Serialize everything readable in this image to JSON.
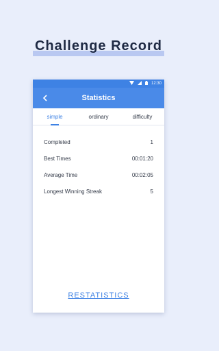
{
  "headline": {
    "title": "Challenge Record"
  },
  "status_bar": {
    "time": "12:30",
    "wifi_icon": "wifi-icon",
    "signal_icon": "signal-icon",
    "battery_icon": "battery-icon"
  },
  "toolbar": {
    "title": "Statistics",
    "back_icon": "back-arrow-icon"
  },
  "tabs": [
    {
      "label": "simple",
      "active": true
    },
    {
      "label": "ordinary",
      "active": false
    },
    {
      "label": "difficulty",
      "active": false
    }
  ],
  "stats": [
    {
      "label": "Completed",
      "value": "1"
    },
    {
      "label": "Best Times",
      "value": "00:01:20"
    },
    {
      "label": "Average Time",
      "value": "00:02:05"
    },
    {
      "label": "Longest Winning Streak",
      "value": "5"
    }
  ],
  "actions": {
    "restatistics_label": "RESTATISTICS"
  },
  "colors": {
    "accent": "#4a8ae8",
    "background": "#e9eefb",
    "headline": "#1f2a44"
  }
}
